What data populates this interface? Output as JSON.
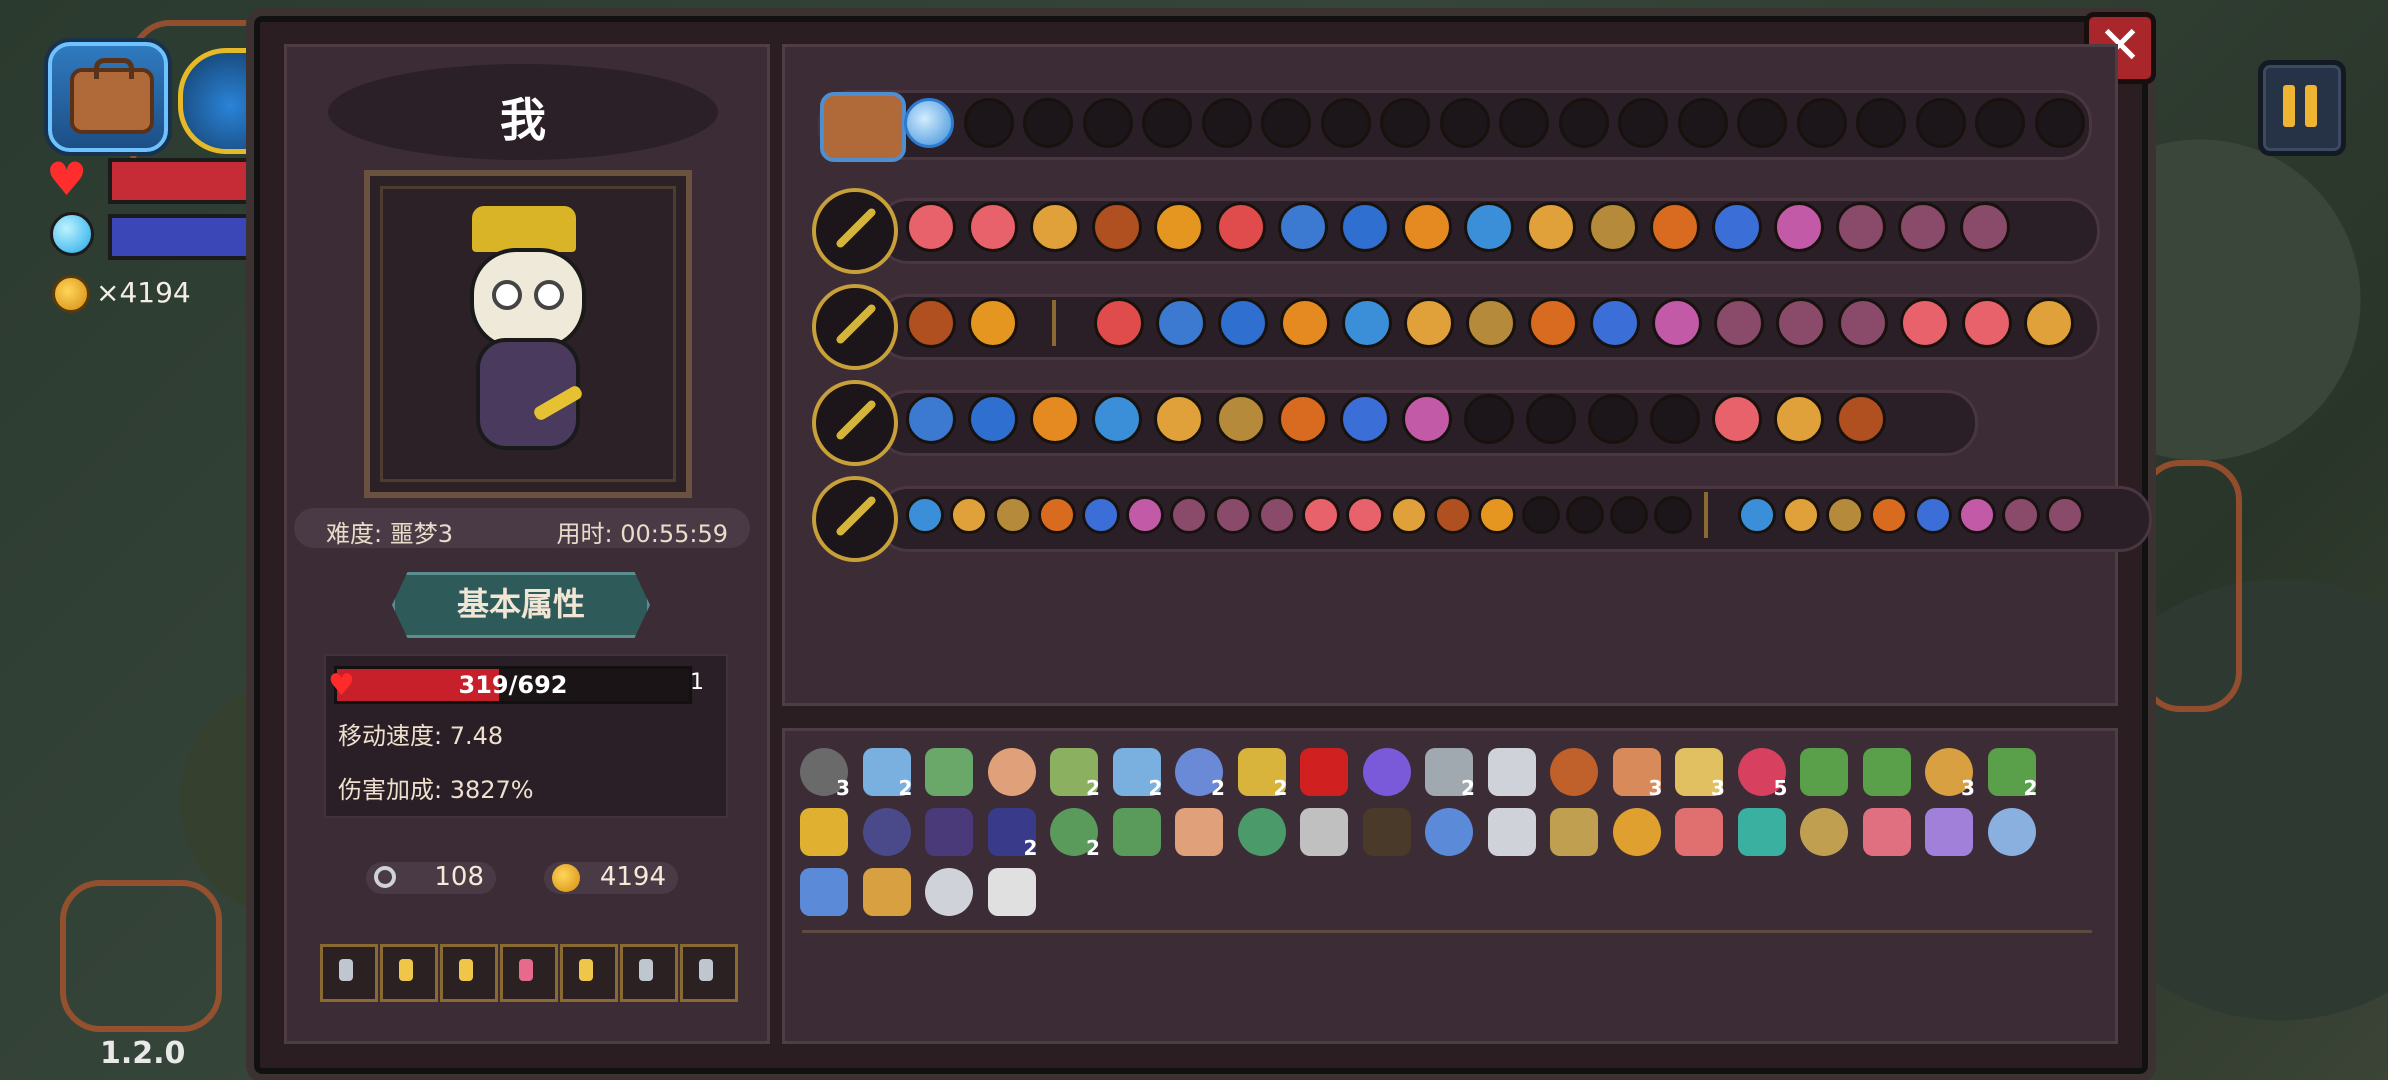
{
  "hud": {
    "coins": "×4194",
    "version": "1.2.0"
  },
  "player": {
    "name": "我",
    "difficulty_label": "难度: 噩梦3",
    "time_label": "用时: 00:55:59",
    "attr_button": "基本属性",
    "hp_text": "319/692",
    "hp_current": 319,
    "hp_max": 692,
    "hp_level": "1",
    "move_speed": "移动速度: 7.48",
    "damage_bonus": "伤害加成: 3827%",
    "keys": "108",
    "gold": "4194"
  },
  "colors": {
    "panel": "#2a1e22",
    "hp": "#c8202b",
    "mp": "#3b47b6",
    "gold": "#d8b426",
    "accent_teal": "#2e5a5a"
  },
  "inventory_bag": {
    "icon": "bag-icon",
    "filled": [
      "blue-orb"
    ],
    "empty_slots": 19
  },
  "wand_rows": [
    {
      "wand": "golden-staff-icon",
      "spells": 18
    },
    {
      "wand": "purple-staff-icon",
      "spells": 18
    },
    {
      "wand": "scepter-icon",
      "spells": 16
    },
    {
      "wand": "dark-blade-icon",
      "spells": 26
    }
  ],
  "relics": {
    "counts": [
      "3",
      "2",
      "2",
      "2",
      "2",
      "2",
      "2",
      "3",
      "3",
      "5",
      "3",
      "2",
      "2",
      "2"
    ]
  },
  "potion_slots": 7
}
